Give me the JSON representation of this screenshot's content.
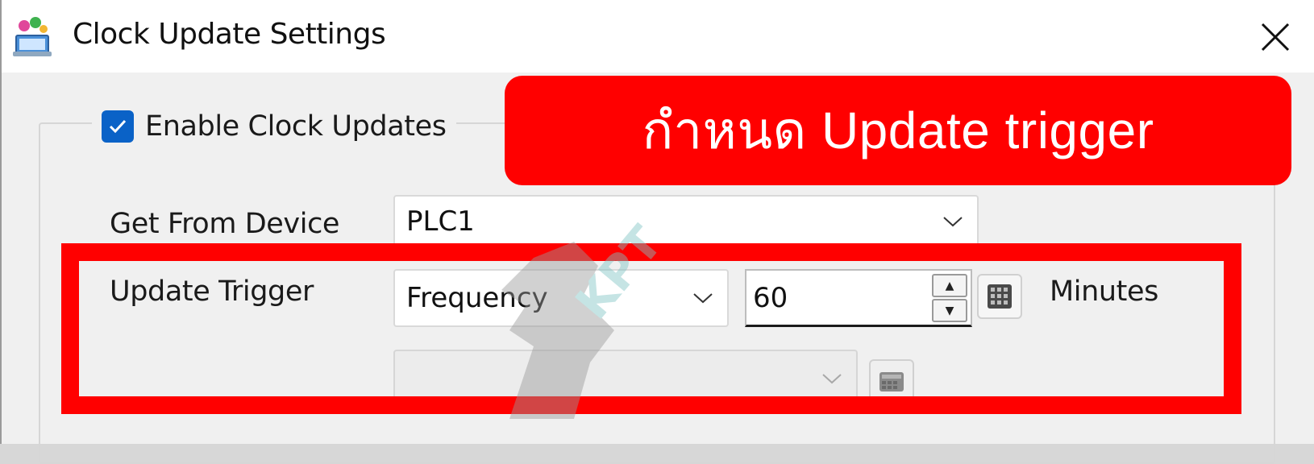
{
  "window": {
    "title": "Clock Update Settings"
  },
  "enable": {
    "label": "Enable Clock Updates",
    "checked": true
  },
  "device": {
    "label": "Get From Device",
    "value": "PLC1"
  },
  "trigger": {
    "label": "Update Trigger",
    "value": "Frequency",
    "amount": "60",
    "unit": "Minutes",
    "secondary_value": ""
  },
  "annotation": {
    "text": "กำหนด Update trigger"
  },
  "colors": {
    "highlight": "#ff0000",
    "checkbox": "#0a62c7"
  },
  "icons": {
    "app": "app-settings-icon",
    "close": "close-icon",
    "check": "checkmark-icon",
    "chevron": "chevron-down-icon",
    "calculator": "calculator-icon"
  }
}
